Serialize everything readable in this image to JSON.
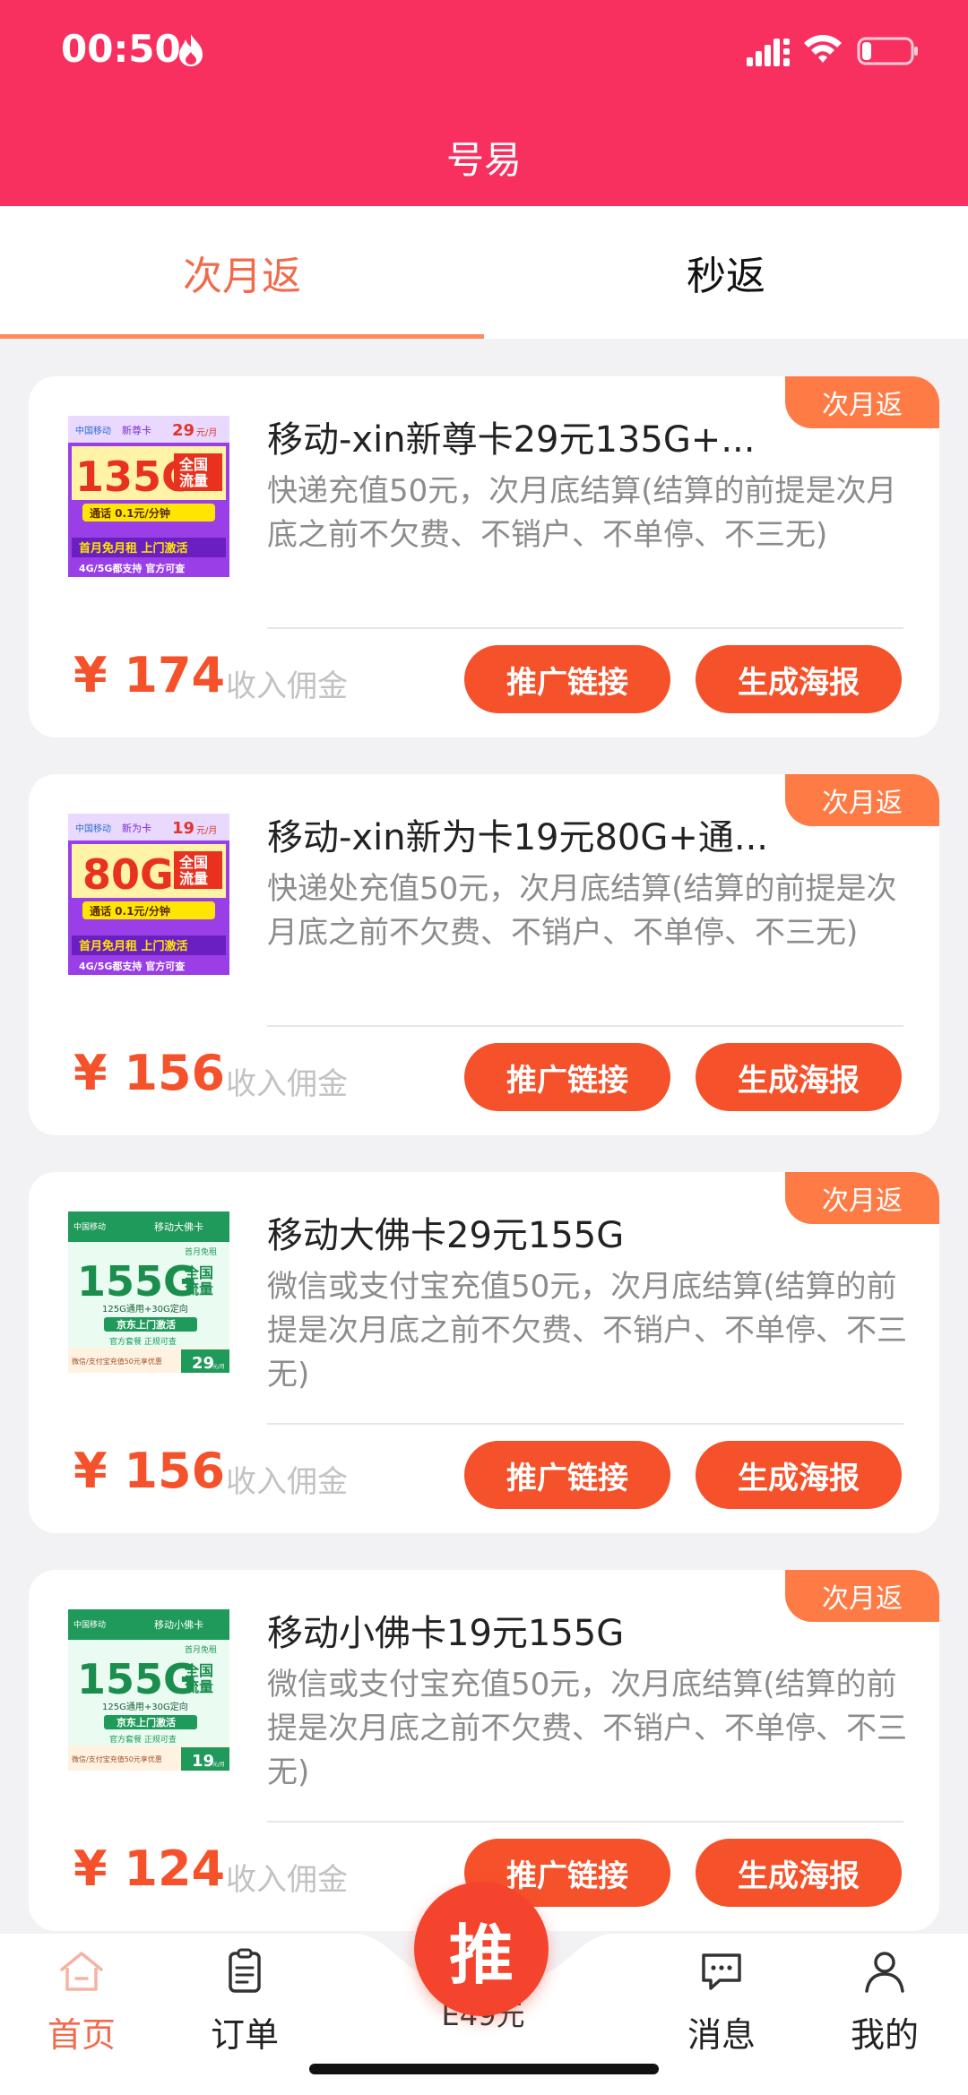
{
  "status_bar": {
    "time": "00:50"
  },
  "header": {
    "title": "号易"
  },
  "tabs": [
    {
      "label": "次月返"
    },
    {
      "label": "秒返"
    }
  ],
  "colors": {
    "header": "#f73060",
    "accent": "#f5512a",
    "badge": "#ff7b45"
  },
  "cards": [
    {
      "badge": "次月返",
      "title": "移动-xin新尊卡29元135G+...",
      "desc": "快递充值50元，次月底结算(结算的前提是次月底之前不欠费、不销户、不单停、不三无)",
      "price": "¥ 174",
      "price_label": "收入佣金",
      "btn_link": "推广链接",
      "btn_poster": "生成海报",
      "thumb": {
        "brand": "中国移动",
        "card_name": "新尊卡",
        "monthly": "29",
        "unit": "元/月",
        "gb": "135G",
        "tag1": "全国",
        "tag2": "流量",
        "call": "通话 0.1元/分钟",
        "promo": "首月免月租 上门激活",
        "support": "4G/5G都支持 官方可查"
      }
    },
    {
      "badge": "次月返",
      "title": "移动-xin新为卡19元80G+通...",
      "desc": "快递处充值50元，次月底结算(结算的前提是次月底之前不欠费、不销户、不单停、不三无)",
      "price": "¥ 156",
      "price_label": "收入佣金",
      "btn_link": "推广链接",
      "btn_poster": "生成海报",
      "thumb": {
        "brand": "中国移动",
        "card_name": "新为卡",
        "monthly": "19",
        "unit": "元/月",
        "gb": "80G",
        "tag1": "全国",
        "tag2": "流量",
        "call": "通话 0.1元/分钟",
        "promo": "首月免月租 上门激活",
        "support": "4G/5G都支持 官方可查"
      }
    },
    {
      "badge": "次月返",
      "title": "移动大佛卡29元155G",
      "desc": "微信或支付宝充值50元，次月底结算(结算的前提是次月底之前不欠费、不销户、不单停、不三无)",
      "price": "¥ 156",
      "price_label": "收入佣金",
      "btn_link": "推广链接",
      "btn_poster": "生成海报",
      "thumb": {
        "brand": "中国移动",
        "card_name": "移动大佛卡",
        "first": "首月免租",
        "gb": "155G",
        "tag1": "全国",
        "tag2": "流量",
        "detail": "125G通用+30G定向",
        "activate": "京东上门激活",
        "official": "官方套餐 正规可查",
        "bottom": "微信/支付宝充值50元享优惠",
        "monthly": "29",
        "unit": "元/月"
      }
    },
    {
      "badge": "次月返",
      "title": "移动小佛卡19元155G",
      "desc": "微信或支付宝充值50元，次月底结算(结算的前提是次月底之前不欠费、不销户、不单停、不三无)",
      "price": "¥ 124",
      "price_label": "收入佣金",
      "btn_link": "推广链接",
      "btn_poster": "生成海报",
      "thumb": {
        "brand": "中国移动",
        "card_name": "移动小佛卡",
        "first": "首月免租",
        "gb": "155G",
        "tag1": "全国",
        "tag2": "流量",
        "detail": "125G通用+30G定向",
        "activate": "京东上门激活",
        "official": "官方套餐 正规可查",
        "bottom": "微信/支付宝充值50元享优惠",
        "monthly": "19",
        "unit": "元/月"
      }
    }
  ],
  "tabbar": {
    "home": "首页",
    "orders": "订单",
    "fab": "推",
    "fab_sub": "E49元",
    "messages": "消息",
    "mine": "我的"
  }
}
